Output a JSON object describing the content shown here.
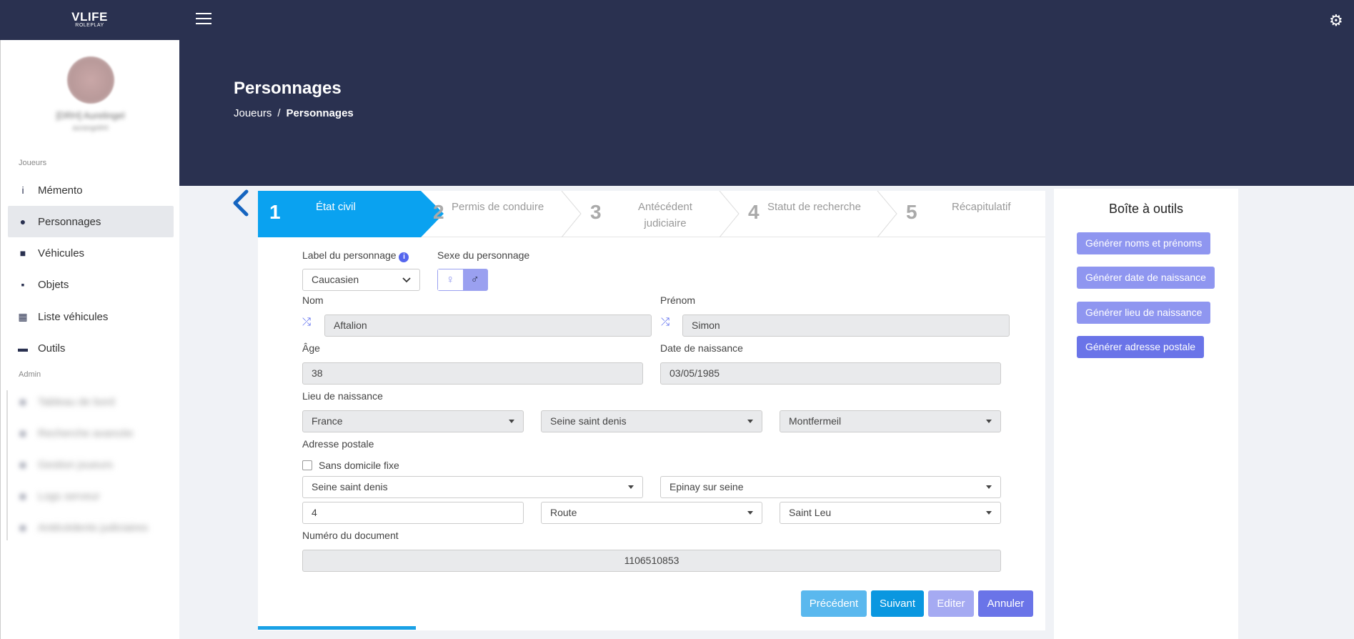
{
  "brand": {
    "name": "VLIFE",
    "sub": "ROLEPLAY"
  },
  "user": {
    "name": "[DRH] Aurelingel",
    "id": "aurangel#4"
  },
  "sidebar": {
    "section1": "Joueurs",
    "items": [
      {
        "label": "Mémento",
        "icon": "info-icon"
      },
      {
        "label": "Personnages",
        "icon": "user-icon"
      },
      {
        "label": "Véhicules",
        "icon": "car-icon"
      },
      {
        "label": "Objets",
        "icon": "box-icon"
      },
      {
        "label": "Liste véhicules",
        "icon": "table-icon"
      },
      {
        "label": "Outils",
        "icon": "toolbox-icon"
      }
    ],
    "section2": "Admin",
    "admin_items": [
      {
        "label": "Tableau de bord"
      },
      {
        "label": "Recherche avancée"
      },
      {
        "label": "Gestion joueurs"
      },
      {
        "label": "Logs serveur"
      },
      {
        "label": "Antécédents judiciaires"
      }
    ]
  },
  "header": {
    "title": "Personnages",
    "breadcrumb": [
      "Joueurs",
      "Personnages"
    ]
  },
  "steps": [
    {
      "num": "1",
      "label": "État civil"
    },
    {
      "num": "2",
      "label": "Permis de conduire"
    },
    {
      "num": "3",
      "label": "Antécédent judiciaire"
    },
    {
      "num": "4",
      "label": "Statut de recherche"
    },
    {
      "num": "5",
      "label": "Récapitulatif"
    }
  ],
  "form": {
    "label_perso": "Label du personnage",
    "label_value": "Caucasien",
    "sexe": "Sexe du personnage",
    "nom_label": "Nom",
    "nom": "Aftalion",
    "prenom_label": "Prénom",
    "prenom": "Simon",
    "age_label": "Âge",
    "age": "38",
    "dob_label": "Date de naissance",
    "dob": "03/05/1985",
    "lieu_label": "Lieu de naissance",
    "pays": "France",
    "dept": "Seine saint denis",
    "ville": "Montfermeil",
    "adresse_label": "Adresse postale",
    "sdf": "Sans domicile fixe",
    "addr_dept": "Seine saint denis",
    "addr_ville": "Epinay sur seine",
    "addr_num": "4",
    "addr_type": "Route",
    "addr_rue": "Saint Leu",
    "doc_label": "Numéro du document",
    "doc": "1106510853"
  },
  "tools": {
    "title": "Boîte à outils",
    "buttons": [
      "Générer noms et prénoms",
      "Générer date de naissance",
      "Générer lieu de naissance",
      "Générer adresse postale"
    ]
  },
  "actions": {
    "prev": "Précédent",
    "next": "Suivant",
    "edit": "Editer",
    "cancel": "Annuler"
  },
  "colors": {
    "header": "#2a3150",
    "active_step": "#0aa2f0",
    "primary": "#6a74e8"
  },
  "progress": 0.2
}
